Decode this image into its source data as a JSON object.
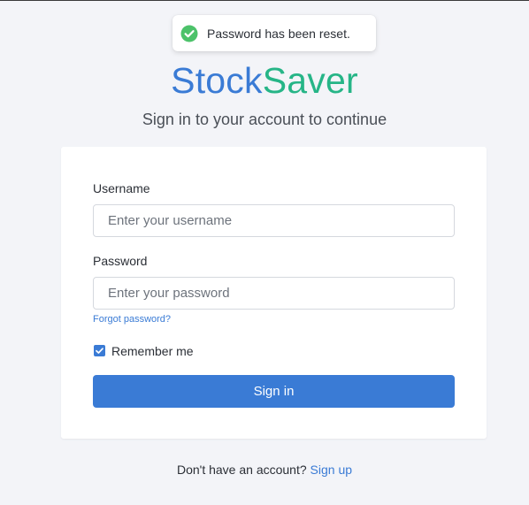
{
  "toast": {
    "message": "Password has been reset.",
    "icon": "check-circle-icon",
    "icon_color": "#4cc26a"
  },
  "brand": {
    "part1": "Stock",
    "part2": "Saver",
    "color1": "#3a7bd5",
    "color2": "#26b587"
  },
  "subtitle": "Sign in to your account to continue",
  "form": {
    "username_label": "Username",
    "username_placeholder": "Enter your username",
    "username_value": "",
    "password_label": "Password",
    "password_placeholder": "Enter your password",
    "password_value": "",
    "forgot_link": "Forgot password?",
    "remember_label": "Remember me",
    "remember_checked": true,
    "signin_label": "Sign in"
  },
  "footer": {
    "prompt": "Don't have an account?",
    "signup_link": "Sign up"
  },
  "colors": {
    "accent": "#3a7bd5",
    "background": "#f3f4f8",
    "success": "#4cc26a"
  }
}
